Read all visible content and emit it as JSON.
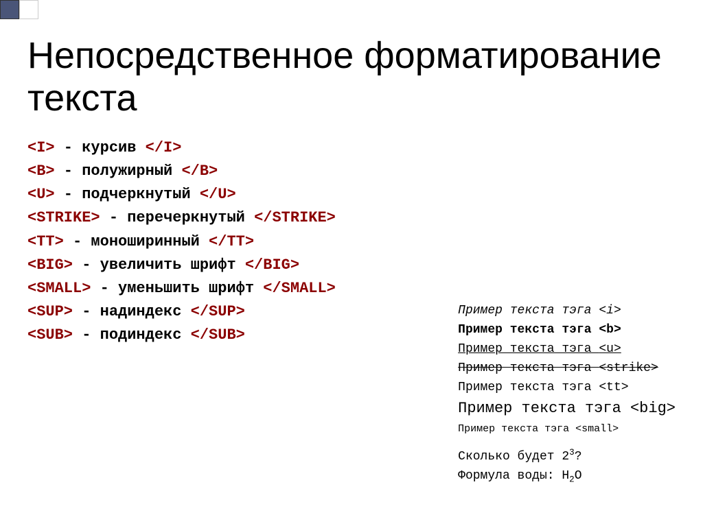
{
  "title": "Непосредственное форматирование текста",
  "tags": [
    {
      "open": "<I>",
      "desc": " - курсив ",
      "close": "</I>"
    },
    {
      "open": "<B>",
      "desc": " - полужирный ",
      "close": "</B>"
    },
    {
      "open": "<U>",
      "desc": " - подчеркнутый ",
      "close": "</U>"
    },
    {
      "open": "<STRIKE>",
      "desc": " - перечеркнутый ",
      "close": "</STRIKE>"
    },
    {
      "open": "<TT>",
      "desc": " - моноширинный ",
      "close": "</TT>"
    },
    {
      "open": "<BIG>",
      "desc": " - увеличить шрифт ",
      "close": "</BIG>"
    },
    {
      "open": "<SMALL>",
      "desc": " - уменьшить шрифт ",
      "close": "</SMALL>"
    },
    {
      "open": "<SUP>",
      "desc": " - надиндекс ",
      "close": "</SUP>"
    },
    {
      "open": "<SUB>",
      "desc": " - подиндекс ",
      "close": "</SUB>"
    }
  ],
  "examples": {
    "prefix": "Пример текста тэга ",
    "tags": [
      "<i>",
      "<b>",
      "<u>",
      "<strike>",
      "<tt>",
      "<big>",
      "<small>"
    ]
  },
  "questions": {
    "q1_prefix": "Сколько будет 2",
    "q1_sup": "3",
    "q1_suffix": "?",
    "q2_prefix": "Формула воды: H",
    "q2_sub": "2",
    "q2_suffix": "O"
  }
}
